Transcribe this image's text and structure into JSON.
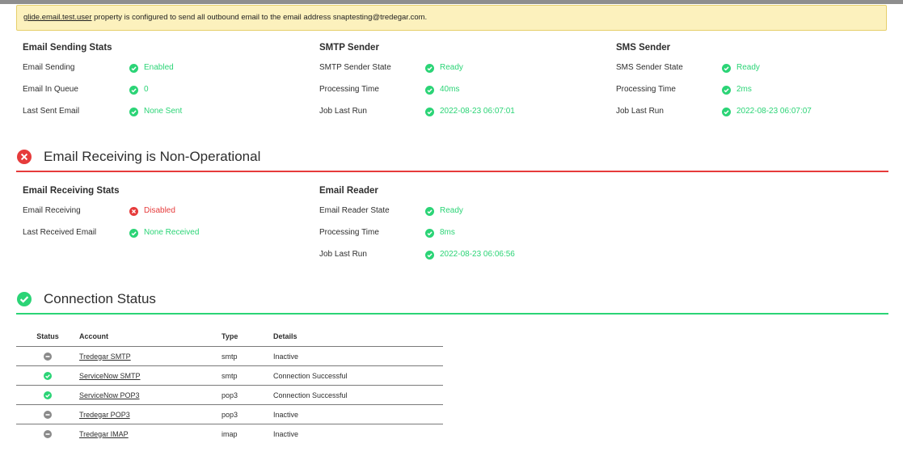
{
  "banner": {
    "property": "glide.email.test.user",
    "message": "property is configured to send all outbound email to the email address snaptesting@tredegar.com."
  },
  "sending": {
    "columns": [
      {
        "title": "Email Sending Stats",
        "rows": [
          {
            "label": "Email Sending",
            "value": "Enabled",
            "status": "ok"
          },
          {
            "label": "Email In Queue",
            "value": "0",
            "status": "ok"
          },
          {
            "label": "Last Sent Email",
            "value": "None Sent",
            "status": "ok"
          }
        ]
      },
      {
        "title": "SMTP Sender",
        "rows": [
          {
            "label": "SMTP Sender State",
            "value": "Ready",
            "status": "ok"
          },
          {
            "label": "Processing Time",
            "value": "40ms",
            "status": "ok"
          },
          {
            "label": "Job Last Run",
            "value": "2022-08-23 06:07:01",
            "status": "ok"
          }
        ]
      },
      {
        "title": "SMS Sender",
        "rows": [
          {
            "label": "SMS Sender State",
            "value": "Ready",
            "status": "ok"
          },
          {
            "label": "Processing Time",
            "value": "2ms",
            "status": "ok"
          },
          {
            "label": "Job Last Run",
            "value": "2022-08-23 06:07:07",
            "status": "ok"
          }
        ]
      }
    ]
  },
  "receiving": {
    "heading": "Email Receiving is Non-Operational",
    "heading_status": "error",
    "columns": [
      {
        "title": "Email Receiving Stats",
        "rows": [
          {
            "label": "Email Receiving",
            "value": "Disabled",
            "status": "error"
          },
          {
            "label": "Last Received Email",
            "value": "None Received",
            "status": "ok"
          }
        ]
      },
      {
        "title": "Email Reader",
        "rows": [
          {
            "label": "Email Reader State",
            "value": "Ready",
            "status": "ok"
          },
          {
            "label": "Processing Time",
            "value": "8ms",
            "status": "ok"
          },
          {
            "label": "Job Last Run",
            "value": "2022-08-23 06:06:56",
            "status": "ok"
          }
        ]
      }
    ]
  },
  "connection": {
    "heading": "Connection Status",
    "heading_status": "ok",
    "headers": {
      "status": "Status",
      "account": "Account",
      "type": "Type",
      "details": "Details"
    },
    "rows": [
      {
        "status": "inactive",
        "account": "Tredegar SMTP",
        "type": "smtp",
        "details": "Inactive"
      },
      {
        "status": "ok",
        "account": "ServiceNow SMTP",
        "type": "smtp",
        "details": "Connection Successful"
      },
      {
        "status": "ok",
        "account": "ServiceNow POP3",
        "type": "pop3",
        "details": "Connection Successful"
      },
      {
        "status": "inactive",
        "account": "Tredegar POP3",
        "type": "pop3",
        "details": "Inactive"
      },
      {
        "status": "inactive",
        "account": "Tredegar IMAP",
        "type": "imap",
        "details": "Inactive"
      }
    ]
  },
  "colors": {
    "ok": "#2bd476",
    "error": "#e63b3b",
    "inactive": "#8a8a8a",
    "banner_bg": "#fcf1bd"
  }
}
